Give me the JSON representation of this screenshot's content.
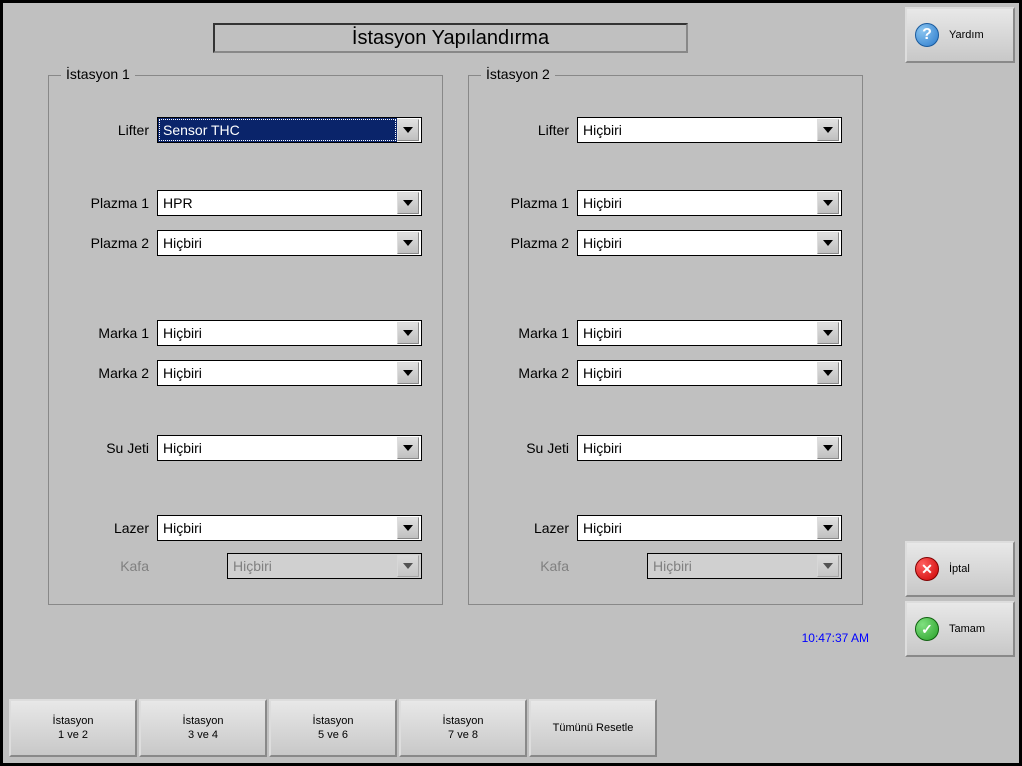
{
  "title": "İstasyon Yapılandırma",
  "help_label": "Yardım",
  "cancel_label": "İptal",
  "ok_label": "Tamam",
  "timestamp": "10:47:37 AM",
  "labels": {
    "lifter": "Lifter",
    "plazma1": "Plazma 1",
    "plazma2": "Plazma 2",
    "marka1": "Marka 1",
    "marka2": "Marka 2",
    "sujeti": "Su Jeti",
    "lazer": "Lazer",
    "kafa": "Kafa"
  },
  "station1": {
    "legend": "İstasyon 1",
    "lifter": "Sensor THC",
    "plazma1": "HPR",
    "plazma2": "Hiçbiri",
    "marka1": "Hiçbiri",
    "marka2": "Hiçbiri",
    "sujeti": "Hiçbiri",
    "lazer": "Hiçbiri",
    "kafa": "Hiçbiri"
  },
  "station2": {
    "legend": "İstasyon 2",
    "lifter": "Hiçbiri",
    "plazma1": "Hiçbiri",
    "plazma2": "Hiçbiri",
    "marka1": "Hiçbiri",
    "marka2": "Hiçbiri",
    "sujeti": "Hiçbiri",
    "lazer": "Hiçbiri",
    "kafa": "Hiçbiri"
  },
  "tabs": {
    "t1a": "İstasyon",
    "t1b": "1 ve 2",
    "t2a": "İstasyon",
    "t2b": "3 ve 4",
    "t3a": "İstasyon",
    "t3b": "5 ve 6",
    "t4a": "İstasyon",
    "t4b": "7 ve 8",
    "t5": "Tümünü Resetle"
  }
}
